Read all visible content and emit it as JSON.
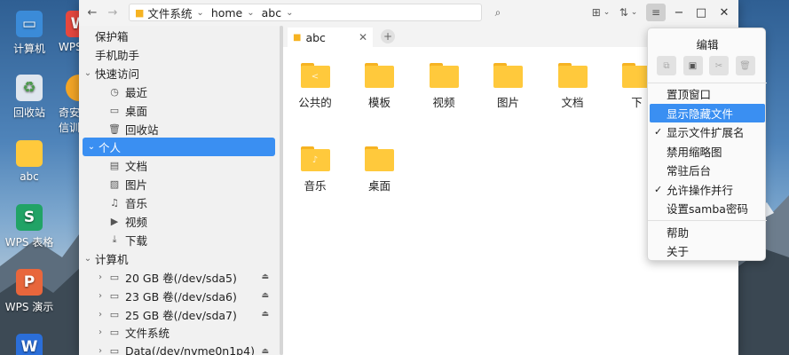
{
  "desktop": {
    "icons": [
      {
        "label": "计算机",
        "icon": "computer-icon",
        "color": "#3b8bd8"
      },
      {
        "label": "WPS",
        "icon": "wps-doc-icon",
        "color": "#e8483f"
      },
      {
        "label": "回收站",
        "icon": "trash-icon",
        "color": "#dfe6ee"
      },
      {
        "label": "奇安",
        "icon": "qianxin-icon",
        "color": "#f4a626"
      },
      {
        "label": "信训",
        "icon": "",
        "color": ""
      },
      {
        "label": "abc",
        "icon": "folder-icon",
        "color": "#ffc93c"
      },
      {
        "label": "WPS 表格",
        "icon": "wps-sheet-icon",
        "color": "#21a366"
      },
      {
        "label": "WPS 演示",
        "icon": "wps-slides-icon",
        "color": "#e8663c"
      },
      {
        "label": "W",
        "icon": "wps-writer-icon",
        "color": "#2b6ed8"
      }
    ]
  },
  "window": {
    "breadcrumb": [
      "文件系统",
      "home",
      "abc"
    ],
    "controls": {
      "minimize": "−",
      "maximize": "□",
      "close": "✕"
    }
  },
  "sidebar": {
    "items": [
      {
        "label": "保护箱",
        "icon": "",
        "level": 0,
        "arrow": ""
      },
      {
        "label": "手机助手",
        "icon": "",
        "level": 0,
        "arrow": ""
      },
      {
        "label": "快速访问",
        "icon": "",
        "level": 0,
        "arrow": "⌄"
      },
      {
        "label": "最近",
        "icon": "clock-icon",
        "level": 1,
        "arrow": ""
      },
      {
        "label": "桌面",
        "icon": "desktop-icon",
        "level": 1,
        "arrow": ""
      },
      {
        "label": "回收站",
        "icon": "trash-icon",
        "level": 1,
        "arrow": ""
      },
      {
        "label": "个人",
        "icon": "",
        "level": 0,
        "arrow": "⌄",
        "selected": true
      },
      {
        "label": "文档",
        "icon": "document-icon",
        "level": 1,
        "arrow": ""
      },
      {
        "label": "图片",
        "icon": "image-icon",
        "level": 1,
        "arrow": ""
      },
      {
        "label": "音乐",
        "icon": "music-icon",
        "level": 1,
        "arrow": ""
      },
      {
        "label": "视频",
        "icon": "video-icon",
        "level": 1,
        "arrow": ""
      },
      {
        "label": "下载",
        "icon": "download-icon",
        "level": 1,
        "arrow": ""
      },
      {
        "label": "计算机",
        "icon": "",
        "level": 0,
        "arrow": "⌄"
      },
      {
        "label": "20 GB 卷(/dev/sda5)",
        "icon": "drive-icon",
        "level": 1,
        "arrow": "›",
        "eject": true
      },
      {
        "label": "23 GB 卷(/dev/sda6)",
        "icon": "drive-icon",
        "level": 1,
        "arrow": "›",
        "eject": true
      },
      {
        "label": "25 GB 卷(/dev/sda7)",
        "icon": "drive-icon",
        "level": 1,
        "arrow": "›",
        "eject": true
      },
      {
        "label": "文件系统",
        "icon": "drive-icon",
        "level": 1,
        "arrow": "›"
      },
      {
        "label": "Data(/dev/nvme0n1p4)",
        "icon": "drive-icon",
        "level": 1,
        "arrow": "›",
        "eject": true
      }
    ]
  },
  "tabs": [
    {
      "label": "abc"
    }
  ],
  "files": [
    {
      "name": "公共的",
      "emblem": "share-emblem"
    },
    {
      "name": "模板",
      "emblem": ""
    },
    {
      "name": "视频",
      "emblem": ""
    },
    {
      "name": "图片",
      "emblem": ""
    },
    {
      "name": "文档",
      "emblem": ""
    },
    {
      "name": "下",
      "emblem": ""
    },
    {
      "name": "音乐",
      "emblem": "music-emblem"
    },
    {
      "name": "桌面",
      "emblem": ""
    }
  ],
  "menu": {
    "header": "编辑",
    "edit_buttons": [
      {
        "icon": "copy-icon",
        "enabled": false
      },
      {
        "icon": "paste-icon",
        "enabled": true
      },
      {
        "icon": "cut-icon",
        "enabled": false
      },
      {
        "icon": "delete-icon",
        "enabled": false
      }
    ],
    "items": [
      {
        "label": "置顶窗口",
        "checked": false,
        "group": 1
      },
      {
        "label": "显示隐藏文件",
        "checked": false,
        "group": 1,
        "highlighted": true
      },
      {
        "label": "显示文件扩展名",
        "checked": true,
        "group": 1
      },
      {
        "label": "禁用缩略图",
        "checked": false,
        "group": 1
      },
      {
        "label": "常驻后台",
        "checked": false,
        "group": 1
      },
      {
        "label": "允许操作并行",
        "checked": true,
        "group": 1
      },
      {
        "label": "设置samba密码",
        "checked": false,
        "group": 1
      },
      {
        "label": "帮助",
        "checked": false,
        "group": 2
      },
      {
        "label": "关于",
        "checked": false,
        "group": 2
      }
    ]
  },
  "colors": {
    "accent": "#3a8ff2",
    "folder": "#ffc93c"
  }
}
